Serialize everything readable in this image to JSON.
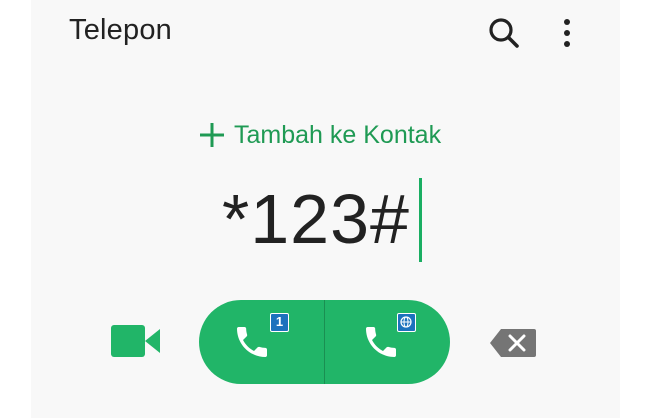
{
  "app": {
    "title": "Telepon"
  },
  "toolbar": {
    "search_icon": "search-icon",
    "more_icon": "more-vert-icon"
  },
  "dialer": {
    "add_contact_label": "Tambah ke Kontak",
    "number": "*123#"
  },
  "actions": {
    "video_call_icon": "video-camera-icon",
    "call_sim1_badge": "1",
    "call_sim2_badge_icon": "globe-icon",
    "backspace_icon": "backspace-icon"
  },
  "colors": {
    "accent_green": "#21b568",
    "text_green": "#1f9a54",
    "sim_badge_blue": "#1d72bd",
    "backspace_gray": "#757575"
  }
}
